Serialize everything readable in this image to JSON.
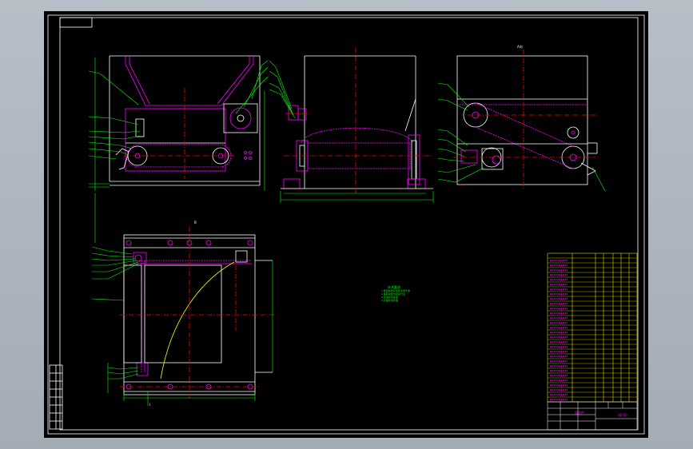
{
  "sheet": {
    "background": "#000000",
    "frame_color": "#ffffff",
    "viewport_color": "#abb3bd"
  },
  "colors": {
    "outline": "#ffffff",
    "part": "#ff00ff",
    "center_line": "#ff0000",
    "dimension": "#00ff00",
    "note": "#00ff00",
    "curve": "#ffff00",
    "table_grid": "#ffff00",
    "table_text": "#ff00ff"
  },
  "views": {
    "side_view_label": "A向",
    "plan_view_label": "B",
    "section_marker": "I"
  },
  "notes": {
    "title": "技术要求",
    "lines": [
      "1.装配前所有零件清洗干净",
      "2.各转动部位转动灵活",
      "3.链条松紧适度",
      "4.表面喷漆处理"
    ]
  },
  "title_block": {
    "stamp": "组合件",
    "drawing_no": "00-00"
  }
}
